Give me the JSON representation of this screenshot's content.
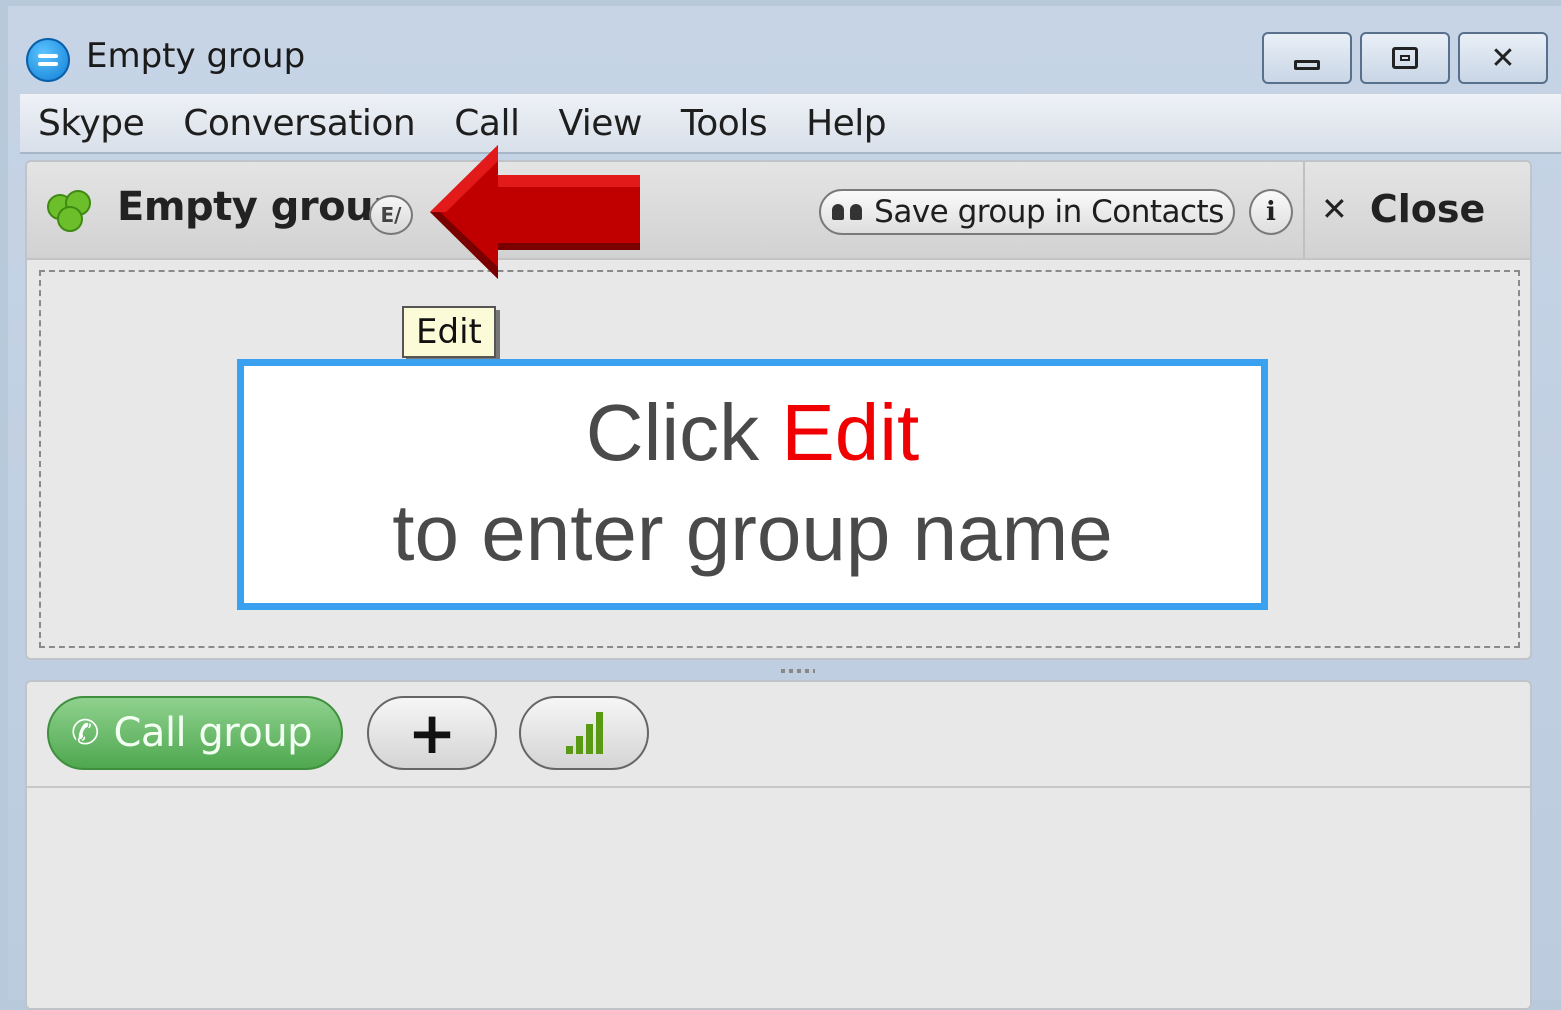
{
  "window": {
    "title": "Empty group",
    "controls": {
      "minimize": "",
      "maximize": "",
      "close": "✕"
    }
  },
  "menu": [
    "Skype",
    "Conversation",
    "Call",
    "View",
    "Tools",
    "Help"
  ],
  "conversation": {
    "group_name": "Empty group",
    "edit_icon_glyph": "E/",
    "save_group_label": "Save group in Contacts",
    "info_glyph": "i",
    "close_glyph": "✕",
    "close_label": "Close"
  },
  "tooltip": "Edit",
  "callout": {
    "line1_prefix": "Click ",
    "line1_highlight": "Edit",
    "line2": "to enter group name"
  },
  "toolbar": {
    "call_label": "Call group",
    "phone_glyph": "✆",
    "add_glyph": "+",
    "signal_bars": 4
  },
  "colors": {
    "accent_blue": "#3aa0f0",
    "highlight_red": "#f00000",
    "call_green": "#4fa84f",
    "arrow_red": "#c00000"
  }
}
